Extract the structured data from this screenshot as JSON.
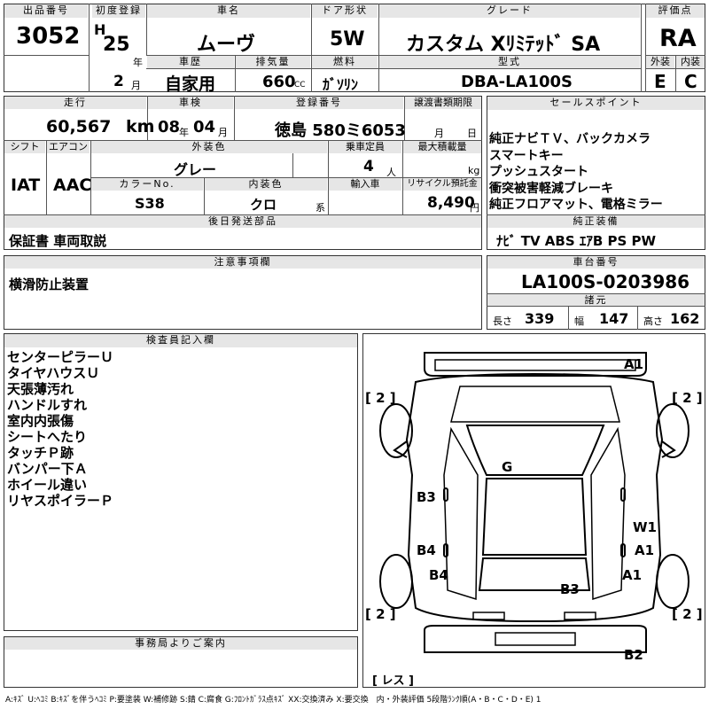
{
  "top": {
    "lot_label": "出品番号",
    "lot": "3052",
    "reg_label": "初度登録",
    "era": "H",
    "year": "25",
    "year_unit": "年",
    "month": "2",
    "month_unit": "月",
    "name_label": "車名",
    "name": "ムーヴ",
    "door_label": "ドア形状",
    "door": "5W",
    "grade_label": "グレード",
    "grade": "カスタム Xﾘﾐﾃｯﾄﾞ SA",
    "score_label": "評価点",
    "score": "RA",
    "history_label": "車歴",
    "history": "自家用",
    "disp_label": "排気量",
    "disp": "660",
    "disp_unit": "CC",
    "fuel_label": "燃料",
    "fuel": "ｶﾞｿﾘﾝ",
    "model_label": "型式",
    "model": "DBA-LA100S",
    "ext_label": "外装",
    "ext": "E",
    "int_label": "内装",
    "int": "C"
  },
  "row2": {
    "mileage_label": "走行",
    "mileage": "60,567",
    "mileage_unit": "km",
    "inspection_label": "車検",
    "insp_year": "08",
    "insp_year_unit": "年",
    "insp_month": "04",
    "insp_month_unit": "月",
    "plate_label": "登録番号",
    "plate": "徳島 580ミ6053",
    "transfer_label": "譲渡書類期限",
    "transfer_month_unit": "月",
    "transfer_day_unit": "日",
    "shift_label": "シフト",
    "shift": "IAT",
    "ac_label": "エアコン",
    "ac": "AAC",
    "color_label": "外装色",
    "color": "グレー",
    "capacity_label": "乗車定員",
    "capacity": "4",
    "capacity_unit": "人",
    "load_label": "最大積載量",
    "load_unit": "kg",
    "colorno_label": "カラーNo.",
    "colorno": "S38",
    "intcolor_label": "内装色",
    "intcolor": "クロ",
    "intcolor_unit": "系",
    "import_label": "輸入車",
    "recycle_label": "リサイクル預託金",
    "recycle": "8,490",
    "recycle_unit": "円",
    "later_label": "後日発送部品",
    "later": "保証書 車両取説"
  },
  "sales": {
    "label": "セールスポイント",
    "items": [
      "純正ナビＴＶ、バックカメラ",
      "スマートキー",
      "プッシュスタート",
      "衝突被害軽減ブレーキ",
      "純正フロアマット、電格ミラー"
    ],
    "equip_label": "純正装備",
    "equip": "ﾅﾋﾞ TV ABS ｴｱB PS PW"
  },
  "notes": {
    "label": "注意事項欄",
    "text": "横滑防止装置"
  },
  "chassis": {
    "label": "車台番号",
    "number": "LA100S-0203986",
    "spec_label": "諸元",
    "len_label": "長さ",
    "len": "339",
    "width_label": "幅",
    "width": "147",
    "height_label": "高さ",
    "height": "162"
  },
  "inspector": {
    "label": "検査員記入欄",
    "items": [
      "センターピラーＵ",
      "タイヤハウスＵ",
      "天張薄汚れ",
      "ハンドルすれ",
      "室内内張傷",
      "シートへたり",
      "タッチＰ跡",
      "バンパー下Ａ",
      "ホイール違い",
      "リヤスポイラーＰ"
    ]
  },
  "diagram": {
    "marks": {
      "a1_top": "A1",
      "g": "G",
      "b3_left": "B3",
      "b4_1": "B4",
      "b4_2": "B4",
      "w1": "W1",
      "a1_mid": "A1",
      "a1_low": "A1",
      "b3_rear": "B3",
      "b2": "B2"
    },
    "tire_fl": "[ 2 ]",
    "tire_fr": "[ 2 ]",
    "tire_rl": "[ 2 ]",
    "tire_rr": "[ 2 ]",
    "spare": "[ レス ]"
  },
  "office": {
    "label": "事務局よりご案内"
  },
  "legend": "A:ｷｽﾞ U:ﾍｺﾐ B:ｷｽﾞを伴うﾍｺﾐ P:要塗装 W:補修跡 S:錆 C:腐食 G:ﾌﾛﾝﾄｶﾞﾗｽ点ｷｽﾞ XX:交換済み X:要交換　内・外装評価 5段階ﾗﾝｸ順(A・B・C・D・E) 1"
}
